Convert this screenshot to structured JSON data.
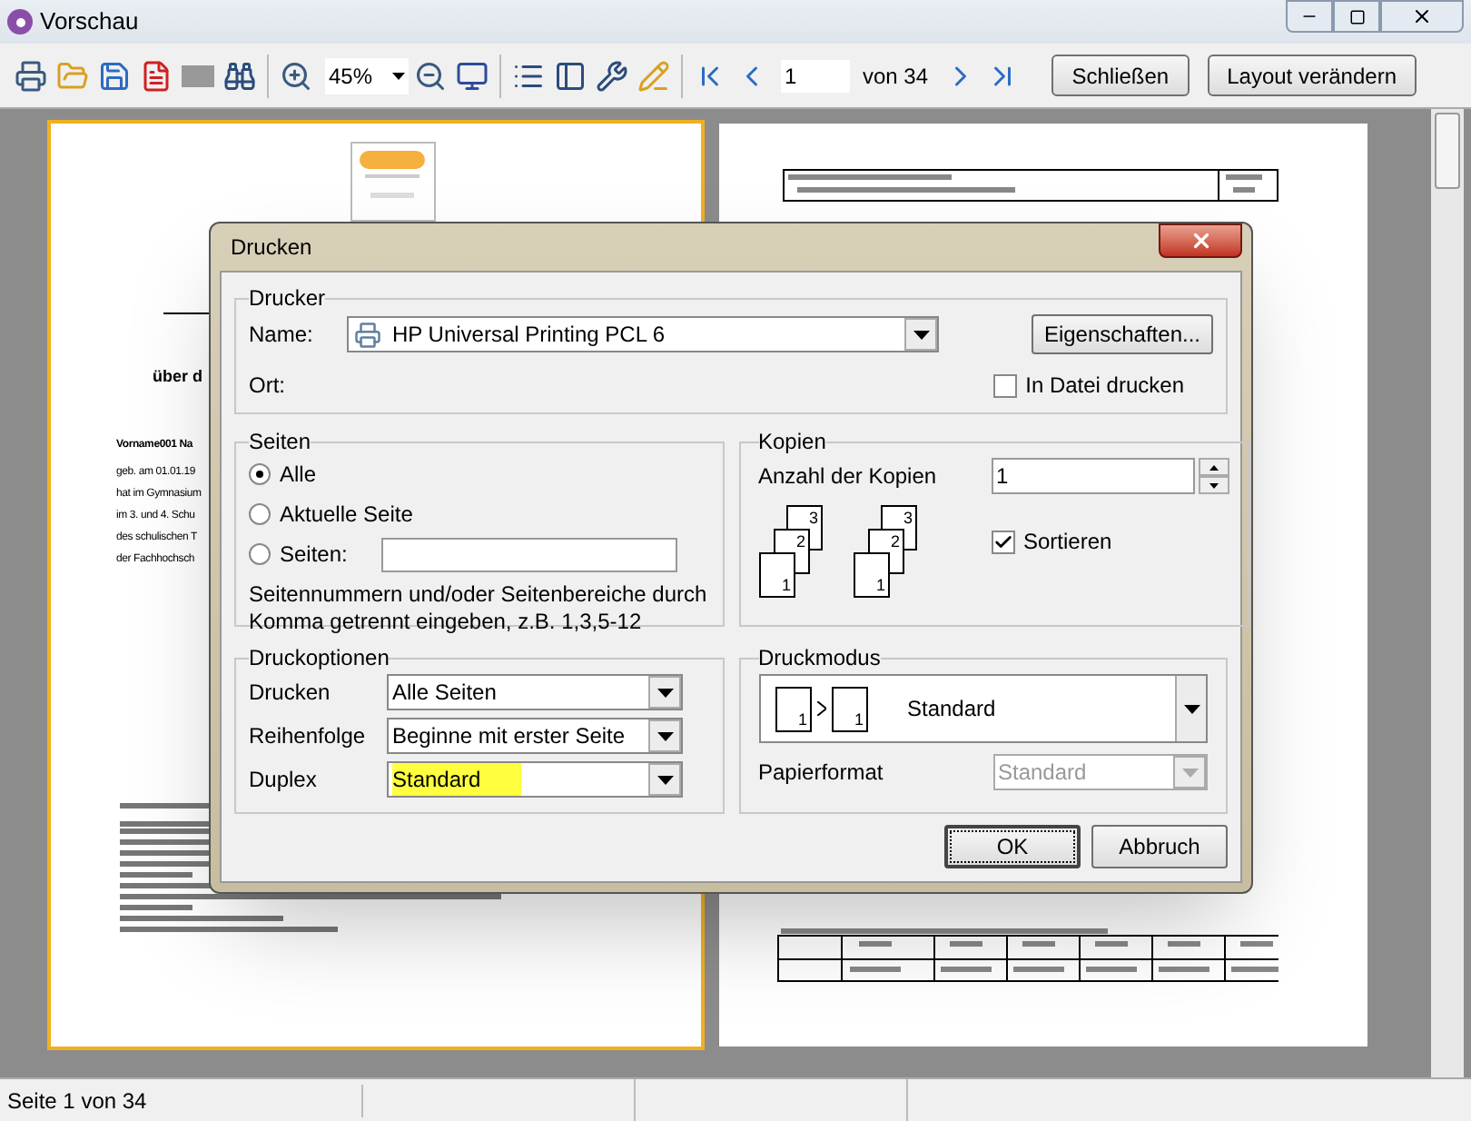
{
  "window": {
    "title": "Vorschau"
  },
  "toolbar": {
    "zoom": "45%",
    "page": "1",
    "page_total": "von 34",
    "buttons": [
      "Schließen",
      "Layout verändern"
    ]
  },
  "preview": {
    "left_page": {
      "heading": "über d",
      "name_line": "Vorname001 Na",
      "lines": [
        "geb. am 01.01.19",
        "hat im Gymnasium",
        "im 3. und 4. Schu",
        "des schulischen T",
        "der Fachhochsch"
      ]
    }
  },
  "dialog": {
    "title": "Drucken",
    "printer": {
      "legend": "Drucker",
      "name_label": "Name:",
      "name": "HP Universal Printing PCL 6",
      "properties": "Eigenschaften...",
      "location_label": "Ort:",
      "to_file": {
        "label": "In Datei drucken",
        "checked": false
      }
    },
    "pages": {
      "legend": "Seiten",
      "options": [
        {
          "label": "Alle",
          "selected": true
        },
        {
          "label": "Aktuelle Seite",
          "selected": false
        },
        {
          "label": "Seiten:",
          "selected": false
        }
      ],
      "hint": "Seitennummern und/oder Seitenbereiche durch Komma getrennt eingeben, z.B. 1,3,5-12"
    },
    "copies": {
      "legend": "Kopien",
      "count_label": "Anzahl der Kopien",
      "count": "1",
      "stacks": [
        [
          "1",
          "2",
          "3"
        ],
        [
          "1",
          "2",
          "3"
        ]
      ],
      "collate": {
        "label": "Sortieren",
        "checked": true
      }
    },
    "options": {
      "legend": "Druckoptionen",
      "rows": [
        {
          "label": "Drucken",
          "value": "Alle Seiten",
          "highlighted": false
        },
        {
          "label": "Reihenfolge",
          "value": "Beginne mit erster Seite",
          "highlighted": false
        },
        {
          "label": "Duplex",
          "value": "Standard",
          "highlighted": true
        }
      ]
    },
    "mode": {
      "legend": "Druckmodus",
      "sheets": [
        "1",
        "1"
      ],
      "value": "Standard",
      "paper_label": "Papierformat",
      "paper": "Standard",
      "paper_disabled": true
    },
    "buttons": [
      {
        "label": "OK",
        "default": true
      },
      {
        "label": "Abbruch",
        "default": false
      }
    ]
  },
  "status_bar": [
    "Seite 1 von 34"
  ]
}
